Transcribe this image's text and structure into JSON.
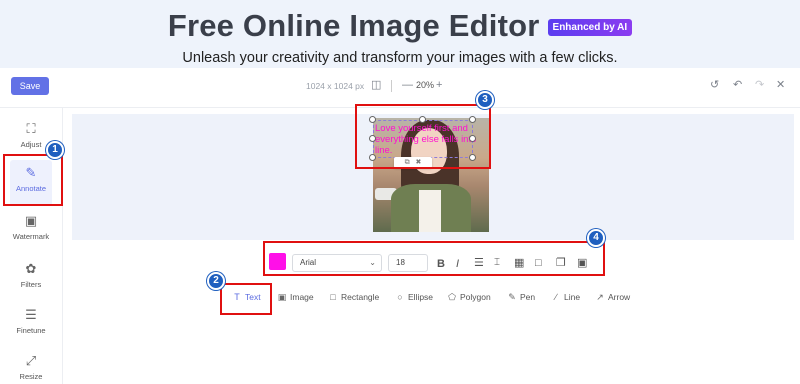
{
  "hero": {
    "title": "Free Online Image Editor",
    "badge": "Enhanced by AI",
    "subtitle": "Unleash your creativity and transform your images with a few clicks."
  },
  "toolbar": {
    "save_label": "Save",
    "dimensions": "1024 x 1024 px",
    "zoom": "20%"
  },
  "sidebar": {
    "items": [
      {
        "label": "Adjust",
        "icon": "crop-icon"
      },
      {
        "label": "Annotate",
        "icon": "pencil-icon"
      },
      {
        "label": "Watermark",
        "icon": "image-icon"
      },
      {
        "label": "Filters",
        "icon": "filters-icon"
      },
      {
        "label": "Finetune",
        "icon": "sliders-icon"
      },
      {
        "label": "Resize",
        "icon": "resize-icon"
      }
    ]
  },
  "canvas": {
    "text_content": "Love yourself first and everything else falls into line.",
    "text_color": "#ff10d0"
  },
  "format_bar": {
    "color": "#ff10e8",
    "font": "Arial",
    "font_size": "18"
  },
  "tools": [
    {
      "label": "Text",
      "icon": "text-icon"
    },
    {
      "label": "Image",
      "icon": "image-icon"
    },
    {
      "label": "Rectangle",
      "icon": "rectangle-icon"
    },
    {
      "label": "Ellipse",
      "icon": "ellipse-icon"
    },
    {
      "label": "Polygon",
      "icon": "polygon-icon"
    },
    {
      "label": "Pen",
      "icon": "pen-icon"
    },
    {
      "label": "Line",
      "icon": "line-icon"
    },
    {
      "label": "Arrow",
      "icon": "arrow-icon"
    }
  ],
  "steps": [
    "1",
    "2",
    "3",
    "4"
  ],
  "colors": {
    "accent": "#6271e6",
    "highlight": "#e01010",
    "step_badge": "#1f5fbf"
  }
}
